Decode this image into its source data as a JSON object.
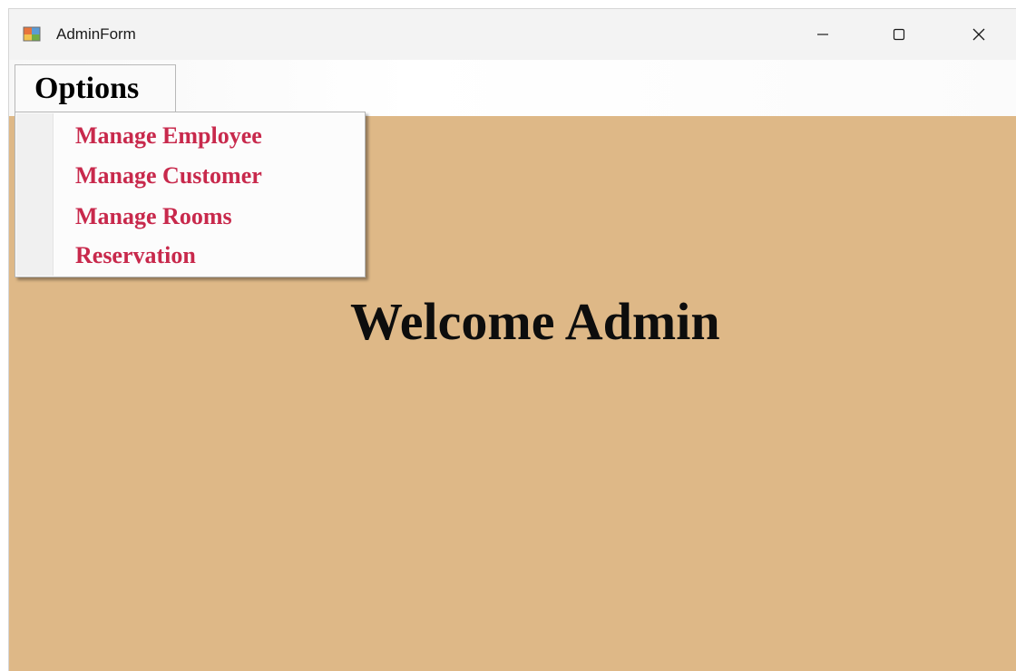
{
  "window": {
    "title": "AdminForm",
    "icon": "windows-form-icon",
    "controls": {
      "minimize_icon": "minimize-icon",
      "maximize_icon": "maximize-icon",
      "close_icon": "close-icon"
    },
    "background_color": "#deb887"
  },
  "menubar": {
    "options_label": "Options",
    "dropdown": {
      "items": [
        {
          "label": "Manage Employee"
        },
        {
          "label": "Manage Customer"
        },
        {
          "label": "Manage Rooms"
        },
        {
          "label": "Reservation"
        }
      ],
      "item_color": "#c8294c"
    }
  },
  "main": {
    "welcome_text": "Welcome Admin"
  }
}
